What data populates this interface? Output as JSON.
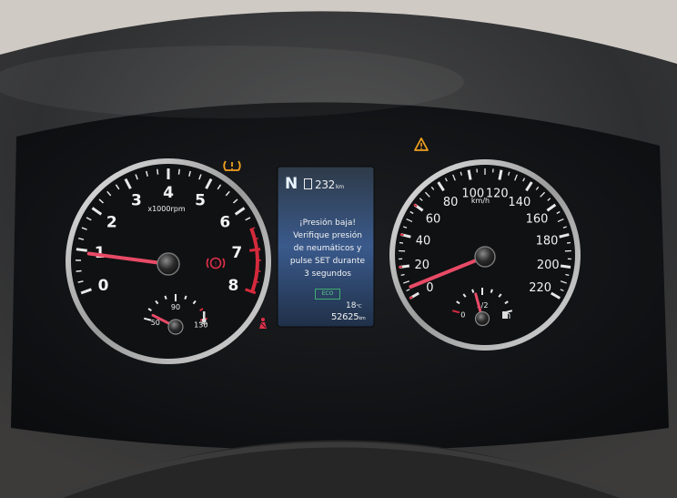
{
  "tachometer": {
    "ticks": [
      "0",
      "1",
      "2",
      "3",
      "4",
      "5",
      "6",
      "7",
      "8"
    ],
    "unit_label": "x1000rpm",
    "reading_krpm": 1.0
  },
  "coolant_gauge": {
    "ticks": [
      "50",
      "90",
      "130"
    ],
    "reading_c": 50
  },
  "speedometer": {
    "left_ticks": [
      "0",
      "20",
      "40",
      "60",
      "80"
    ],
    "right_ticks": [
      "100",
      "120",
      "140",
      "160",
      "180",
      "200",
      "220"
    ],
    "unit_label": "km/h",
    "reading_kmh": 0
  },
  "fuel_gauge": {
    "ticks": [
      "0",
      "1/2"
    ],
    "reading_fraction": 0.1
  },
  "display": {
    "gear": "N",
    "range_value": "232",
    "range_unit": "km",
    "message_lines": [
      "¡Presión baja!",
      "Verifique presión",
      "de neumáticos y",
      "pulse SET durante",
      "3 segundos"
    ],
    "eco_label": "ECO",
    "outside_temp": "18",
    "outside_temp_unit": "°C",
    "odometer_value": "52625",
    "odometer_unit": "km"
  },
  "warning_lights": {
    "tpms_icon": "tire-pressure-warning-icon",
    "master_warning_icon": "triangle-warning-icon",
    "brake_icon": "parking-brake-icon",
    "seatbelt_icon": "seatbelt-warning-icon",
    "fuel_pump_icon": "fuel-pump-icon",
    "amber": "#f0a020",
    "red": "#e0304a"
  },
  "colors": {
    "needle": "#e84a66",
    "red_zone": "#d42a3c",
    "dial_face": "#101214",
    "bezel": "#c9c9c9"
  }
}
